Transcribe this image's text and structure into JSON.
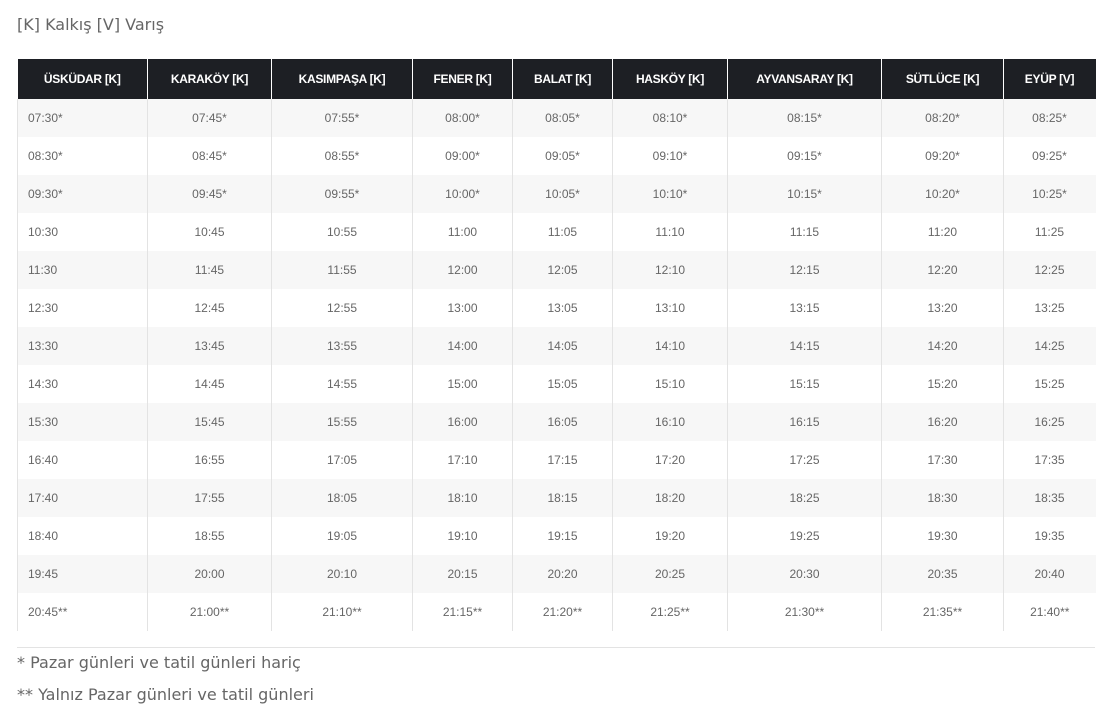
{
  "legend": "[K] Kalkış [V] Varış",
  "table": {
    "headers": [
      "ÜSKÜDAR [K]",
      "KARAKÖY [K]",
      "KASIMPAŞA [K]",
      "FENER [K]",
      "BALAT [K]",
      "HASKÖY [K]",
      "AYVANSARAY [K]",
      "SÜTLÜCE [K]",
      "EYÜP [V]"
    ],
    "rows": [
      [
        "07:30*",
        "07:45*",
        "07:55*",
        "08:00*",
        "08:05*",
        "08:10*",
        "08:15*",
        "08:20*",
        "08:25*"
      ],
      [
        "08:30*",
        "08:45*",
        "08:55*",
        "09:00*",
        "09:05*",
        "09:10*",
        "09:15*",
        "09:20*",
        "09:25*"
      ],
      [
        "09:30*",
        "09:45*",
        "09:55*",
        "10:00*",
        "10:05*",
        "10:10*",
        "10:15*",
        "10:20*",
        "10:25*"
      ],
      [
        "10:30",
        "10:45",
        "10:55",
        "11:00",
        "11:05",
        "11:10",
        "11:15",
        "11:20",
        "11:25"
      ],
      [
        "11:30",
        "11:45",
        "11:55",
        "12:00",
        "12:05",
        "12:10",
        "12:15",
        "12:20",
        "12:25"
      ],
      [
        "12:30",
        "12:45",
        "12:55",
        "13:00",
        "13:05",
        "13:10",
        "13:15",
        "13:20",
        "13:25"
      ],
      [
        "13:30",
        "13:45",
        "13:55",
        "14:00",
        "14:05",
        "14:10",
        "14:15",
        "14:20",
        "14:25"
      ],
      [
        "14:30",
        "14:45",
        "14:55",
        "15:00",
        "15:05",
        "15:10",
        "15:15",
        "15:20",
        "15:25"
      ],
      [
        "15:30",
        "15:45",
        "15:55",
        "16:00",
        "16:05",
        "16:10",
        "16:15",
        "16:20",
        "16:25"
      ],
      [
        "16:40",
        "16:55",
        "17:05",
        "17:10",
        "17:15",
        "17:20",
        "17:25",
        "17:30",
        "17:35"
      ],
      [
        "17:40",
        "17:55",
        "18:05",
        "18:10",
        "18:15",
        "18:20",
        "18:25",
        "18:30",
        "18:35"
      ],
      [
        "18:40",
        "18:55",
        "19:05",
        "19:10",
        "19:15",
        "19:20",
        "19:25",
        "19:30",
        "19:35"
      ],
      [
        "19:45",
        "20:00",
        "20:10",
        "20:15",
        "20:20",
        "20:25",
        "20:30",
        "20:35",
        "20:40"
      ],
      [
        "20:45**",
        "21:00**",
        "21:10**",
        "21:15**",
        "21:20**",
        "21:25**",
        "21:30**",
        "21:35**",
        "21:40**"
      ]
    ]
  },
  "notes": {
    "weekday_only": "* Pazar günleri ve tatil günleri hariç",
    "sunday_only": "** Yalnız Pazar günleri ve tatil günleri"
  },
  "colors": {
    "header_bg": "#1d1f24",
    "header_text": "#ffffff",
    "row_alt_bg": "#f7f7f7",
    "text": "#666666"
  }
}
